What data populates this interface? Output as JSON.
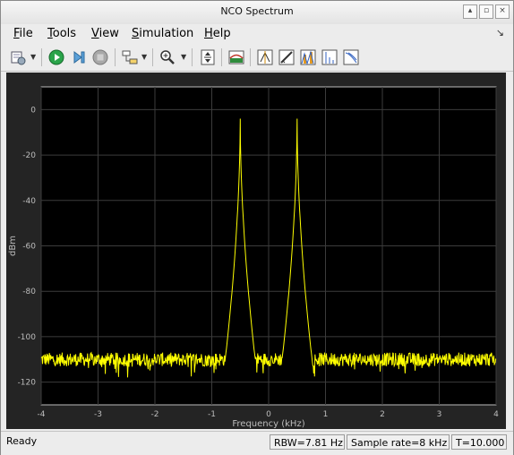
{
  "window": {
    "title": "NCO Spectrum"
  },
  "menubar": {
    "items": [
      {
        "key": "F",
        "rest": "ile"
      },
      {
        "key": "T",
        "rest": "ools"
      },
      {
        "key": "V",
        "rest": "iew"
      },
      {
        "key": "S",
        "rest": "imulation"
      },
      {
        "key": "H",
        "rest": "elp"
      }
    ]
  },
  "toolbar": {
    "icons": [
      "settings-icon",
      "play-icon",
      "step-forward-icon",
      "stop-icon",
      "highlight-signal-icon",
      "zoom-in-icon",
      "scale-axes-icon",
      "spectrum-settings-icon",
      "data-cursors-icon",
      "measurements-icon",
      "peak-finder-icon",
      "distortion-icon",
      "ccdf-icon"
    ]
  },
  "chart_data": {
    "type": "line",
    "xlabel": "Frequency (kHz)",
    "ylabel": "dBm",
    "xlim": [
      -4,
      4
    ],
    "ylim": [
      -130,
      10
    ],
    "xticks": [
      "-4",
      "-3",
      "-2",
      "-1",
      "0",
      "1",
      "2",
      "3",
      "4"
    ],
    "yticks": [
      "0",
      "-20",
      "-40",
      "-60",
      "-80",
      "-100",
      "-120"
    ],
    "grid": true,
    "line_color": "#ffff00",
    "series": [
      {
        "noise_floor_dbm": -110,
        "peaks": [
          {
            "x": -0.5,
            "y": -4
          },
          {
            "x": 0.5,
            "y": -4
          }
        ]
      }
    ]
  },
  "status": {
    "left": "Ready",
    "rbw": "RBW=7.81 Hz",
    "sample_rate": "Sample rate=8 kHz",
    "time": "T=10.000"
  }
}
